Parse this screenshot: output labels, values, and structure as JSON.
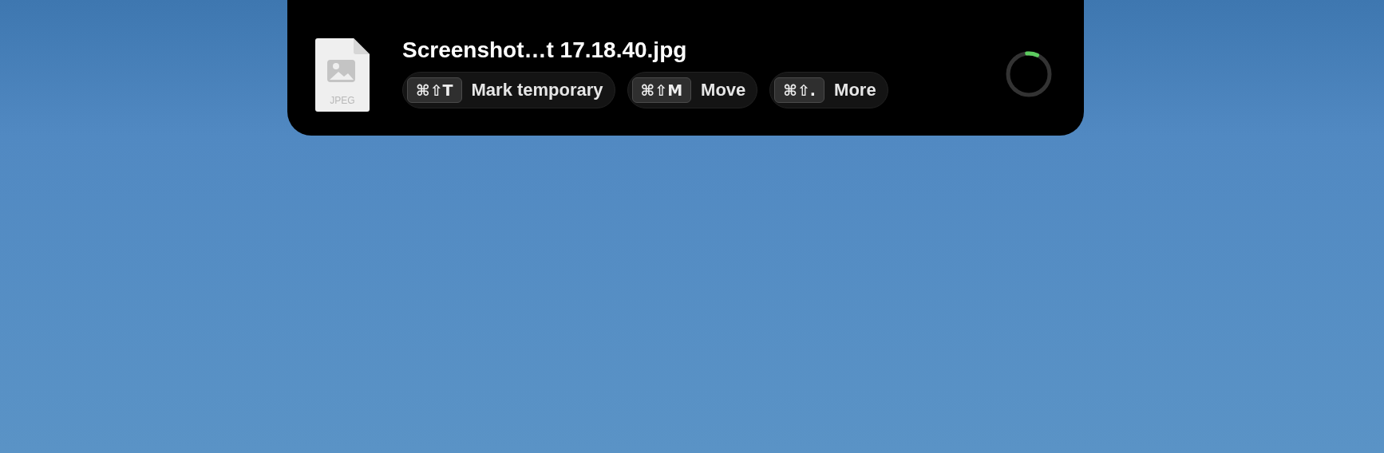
{
  "file": {
    "type_label": "JPEG",
    "name": "Screenshot…t 17.18.40.jpg"
  },
  "actions": [
    {
      "shortcut": "⌘⇧T",
      "label": "Mark temporary"
    },
    {
      "shortcut": "⌘⇧M",
      "label": "Move"
    },
    {
      "shortcut": "⌘⇧.",
      "label": "More"
    }
  ],
  "progress": {
    "level": 0.08
  }
}
